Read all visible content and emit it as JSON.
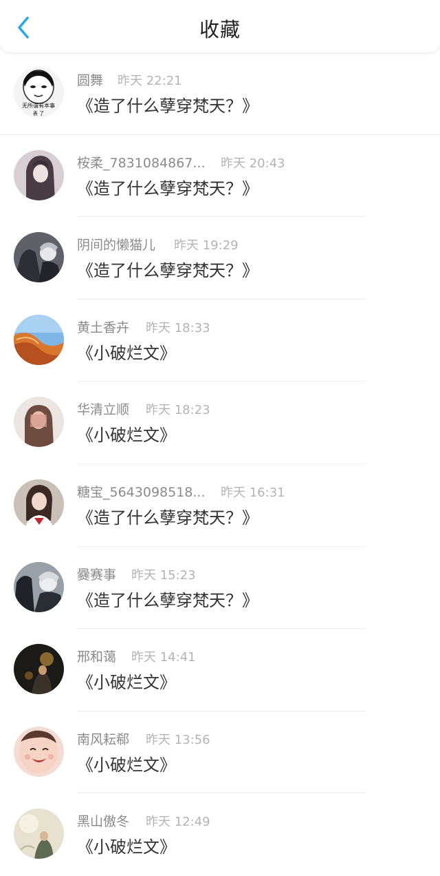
{
  "header": {
    "title": "收藏",
    "back_icon": "chevron-left-icon",
    "accent_color": "#2aa7e6"
  },
  "favorites": [
    {
      "user": "圆舞",
      "time": "昨天 22:21",
      "book": "《造了什么孽穿梵天？》"
    },
    {
      "user": "桉柔_7831084867...",
      "time": "昨天 20:43",
      "book": "《造了什么孽穿梵天？》"
    },
    {
      "user": "阴间的懒猫儿",
      "time": "昨天 19:29",
      "book": "《造了什么孽穿梵天？》"
    },
    {
      "user": "黄土香卉",
      "time": "昨天 18:33",
      "book": "《小破烂文》"
    },
    {
      "user": "华清立顺",
      "time": "昨天 18:23",
      "book": "《小破烂文》"
    },
    {
      "user": "糖宝_5643098518...",
      "time": "昨天 16:31",
      "book": "《造了什么孽穿梵天？》"
    },
    {
      "user": "爨赛事",
      "time": "昨天 15:23",
      "book": "《造了什么孽穿梵天？》"
    },
    {
      "user": "邢和蔼",
      "time": "昨天 14:41",
      "book": "《小破烂文》"
    },
    {
      "user": "南风耘郗",
      "time": "昨天 13:56",
      "book": "《小破烂文》"
    },
    {
      "user": "黑山傲冬",
      "time": "昨天 12:49",
      "book": "《小破烂文》"
    }
  ],
  "avatar_meme_text": [
    "无所谓有本事",
    "表 了"
  ]
}
